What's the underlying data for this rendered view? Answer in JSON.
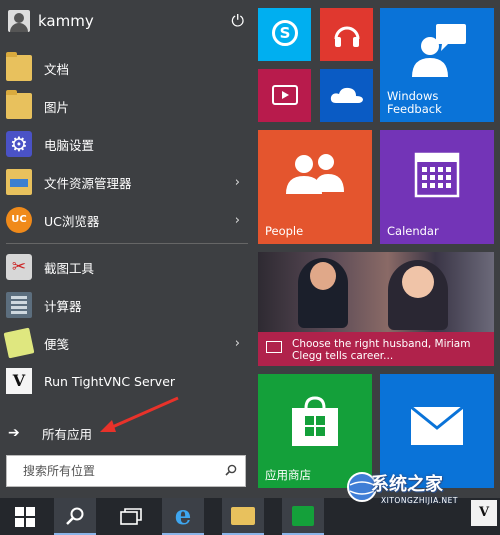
{
  "user": {
    "name": "kammy"
  },
  "left_items": [
    {
      "label": "文档",
      "icon": "documents-folder-icon"
    },
    {
      "label": "图片",
      "icon": "pictures-folder-icon"
    },
    {
      "label": "电脑设置",
      "icon": "settings-gear-icon"
    },
    {
      "label": "文件资源管理器",
      "icon": "file-explorer-icon",
      "arrow": "›"
    },
    {
      "label": "UC浏览器",
      "icon": "uc-browser-icon",
      "arrow": "›"
    },
    {
      "label": "截图工具",
      "icon": "snipping-tool-icon"
    },
    {
      "label": "计算器",
      "icon": "calculator-icon"
    },
    {
      "label": "便笺",
      "icon": "sticky-notes-icon",
      "arrow": "›"
    },
    {
      "label": "Run TightVNC Server",
      "icon": "tightvnc-icon"
    }
  ],
  "all_apps": {
    "label": "所有应用",
    "icon": "arrow-right-icon"
  },
  "search": {
    "placeholder": "搜索所有位置",
    "icon": "search-icon"
  },
  "tiles": {
    "feedback": "Windows Feedback",
    "people": "People",
    "calendar": "Calendar",
    "news": "Choose the right husband, Miriam Clegg tells career...",
    "store": "应用商店"
  },
  "taskbar": [
    "start-button",
    "search-button",
    "task-view-button",
    "internet-explorer",
    "file-explorer",
    "store",
    "uc-browser",
    "tightvnc"
  ],
  "watermark": {
    "title": "系统之家",
    "subtitle": "XITONGZHIJIA.NET"
  },
  "colors": {
    "accent": "#0a73d8",
    "people": "#e4552e",
    "calendar": "#7334b7",
    "store": "#14a03a",
    "news": "#b0224b"
  }
}
